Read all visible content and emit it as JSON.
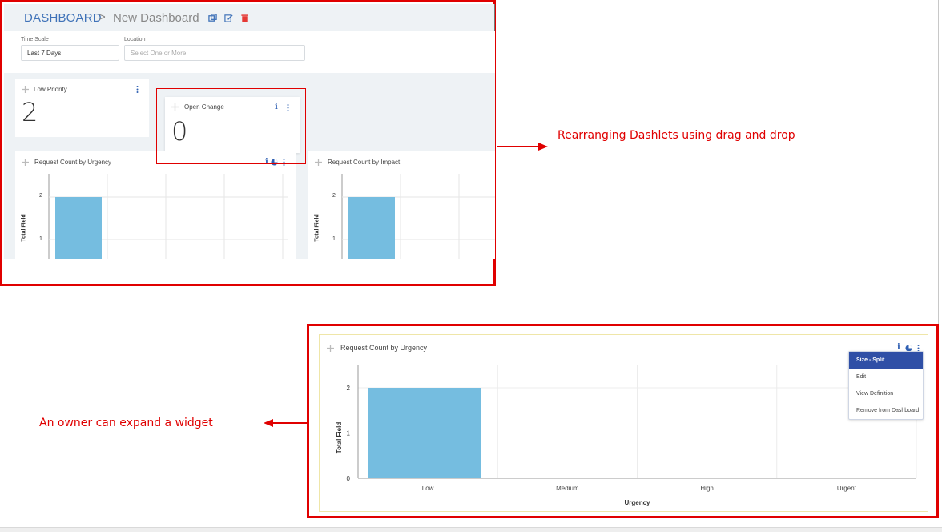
{
  "header": {
    "crumb_root": "DASHBOARD",
    "crumb_sep": ">",
    "crumb_current": "New Dashboard"
  },
  "filters": {
    "time_scale_label": "Time Scale",
    "time_scale_value": "Last 7 Days",
    "location_label": "Location",
    "location_placeholder": "Select One or More"
  },
  "cards": {
    "low_priority": {
      "title": "Low Priority",
      "value": "2"
    },
    "open_change": {
      "title": "Open Change",
      "value": "0"
    },
    "urgency_small": {
      "title": "Request Count by Urgency",
      "ylabel": "Total Field",
      "ticks": [
        "2",
        "1"
      ]
    },
    "impact_small": {
      "title": "Request Count by Impact",
      "ylabel": "Total Field",
      "ticks": [
        "2",
        "1"
      ]
    }
  },
  "annotations": {
    "drag_drop": "Rearranging Dashlets using drag and drop",
    "expand": "An owner can expand a widget"
  },
  "expanded": {
    "title": "Request Count by Urgency",
    "menu": [
      "Size - Split",
      "Edit",
      "View Definition",
      "Remove from Dashboard"
    ]
  },
  "colors": {
    "accent": "#3f72b8",
    "bar": "#75bde0",
    "annotation": "#e00000",
    "menu_active": "#2f4fa6",
    "delete": "#e53935"
  },
  "chart_data": {
    "type": "bar",
    "title": "Request Count by Urgency",
    "categories": [
      "Low",
      "Medium",
      "High",
      "Urgent"
    ],
    "values": [
      2,
      0,
      0,
      0
    ],
    "xlabel": "Urgency",
    "ylabel": "Total Field",
    "ylim": [
      0,
      2
    ],
    "yticks": [
      "0",
      "1",
      "2"
    ],
    "grid": true
  }
}
